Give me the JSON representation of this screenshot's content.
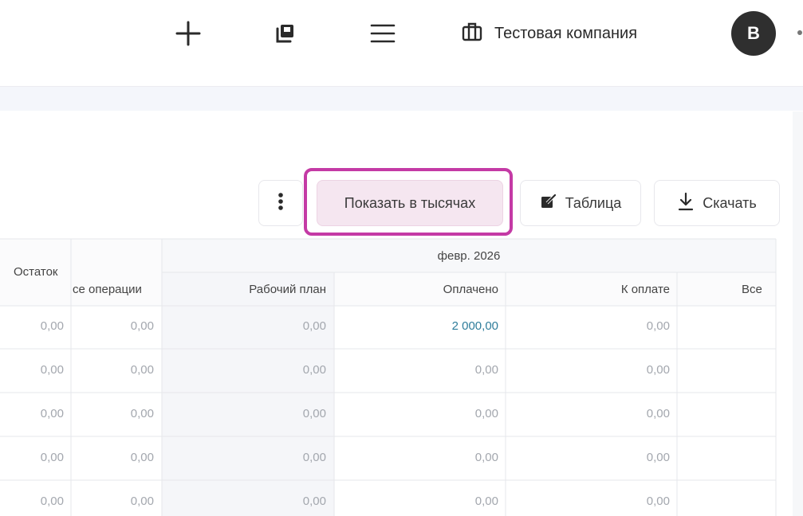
{
  "topbar": {
    "add_icon": "plus-icon",
    "copy_icon": "copy-icon",
    "menu_icon": "hamburger-icon",
    "company_icon": "briefcase-icon",
    "company_name": "Тестовая компания",
    "avatar_letter": "В"
  },
  "toolbar": {
    "more_icon": "vertical-dots-icon",
    "thousands_label": "Показать в тысячах",
    "table_icon": "edit-icon",
    "table_label": "Таблица",
    "download_icon": "download-icon",
    "download_label": "Скачать",
    "highlight_color": "#c43aa5"
  },
  "table": {
    "left_headers": {
      "balance": "Остаток",
      "all_ops": "се операции"
    },
    "group_header": "февр. 2026",
    "columns": [
      "Рабочий план",
      "Оплачено",
      "К оплате",
      "Все"
    ],
    "rows": [
      {
        "balance": "0,00",
        "all_ops": "0,00",
        "plan": "0,00",
        "paid": "2 000,00",
        "to_pay": "0,00"
      },
      {
        "balance": "0,00",
        "all_ops": "0,00",
        "plan": "0,00",
        "paid": "0,00",
        "to_pay": "0,00"
      },
      {
        "balance": "0,00",
        "all_ops": "0,00",
        "plan": "0,00",
        "paid": "0,00",
        "to_pay": "0,00"
      },
      {
        "balance": "0,00",
        "all_ops": "0,00",
        "plan": "0,00",
        "paid": "0,00",
        "to_pay": "0,00"
      },
      {
        "balance": "0,00",
        "all_ops": "0,00",
        "plan": "0,00",
        "paid": "0,00",
        "to_pay": "0,00"
      }
    ],
    "link_color": "#2f7d9b"
  }
}
